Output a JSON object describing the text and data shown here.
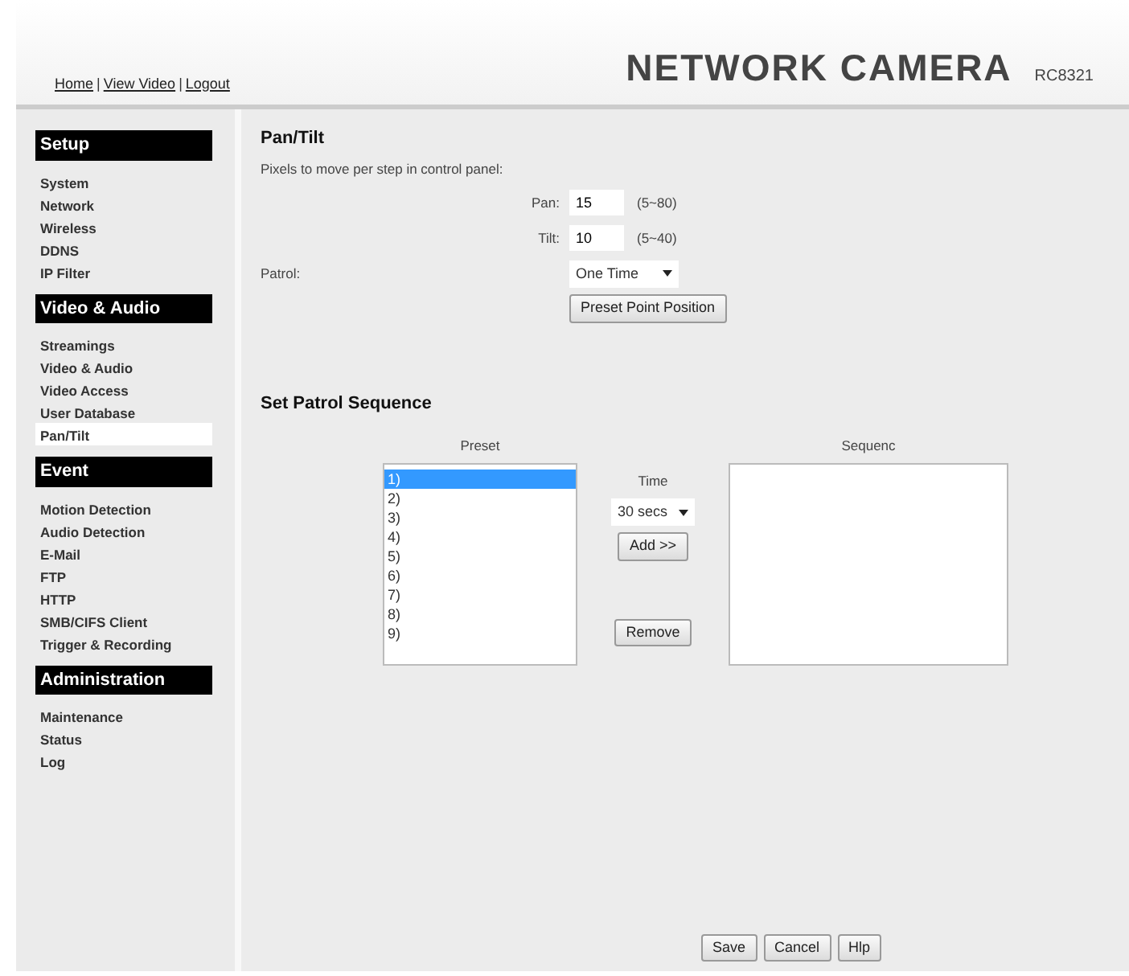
{
  "header": {
    "links": [
      "Home",
      "View Video",
      "Logout"
    ],
    "separator": "|",
    "title": "NETWORK CAMERA",
    "model": "RC8321"
  },
  "sidebar": [
    {
      "heading": "Setup",
      "items": [
        {
          "label": "System",
          "selected": false
        },
        {
          "label": "Network",
          "selected": false
        },
        {
          "label": "Wireless",
          "selected": false
        },
        {
          "label": "DDNS",
          "selected": false
        },
        {
          "label": "IP Filter",
          "selected": false
        }
      ]
    },
    {
      "heading": "Video & Audio",
      "items": [
        {
          "label": "Streamings",
          "selected": false
        },
        {
          "label": "Video & Audio",
          "selected": false
        },
        {
          "label": "Video Access",
          "selected": false
        },
        {
          "label": "User Database",
          "selected": false
        },
        {
          "label": "Pan/Tilt",
          "selected": true
        }
      ]
    },
    {
      "heading": "Event",
      "items": [
        {
          "label": "Motion Detection",
          "selected": false
        },
        {
          "label": "Audio Detection",
          "selected": false
        },
        {
          "label": "E-Mail",
          "selected": false
        },
        {
          "label": "FTP",
          "selected": false
        },
        {
          "label": "HTTP",
          "selected": false
        },
        {
          "label": "SMB/CIFS Client",
          "selected": false
        },
        {
          "label": "Trigger & Recording",
          "selected": false
        }
      ]
    },
    {
      "heading": "Administration",
      "items": [
        {
          "label": "Maintenance",
          "selected": false
        },
        {
          "label": "Status",
          "selected": false
        },
        {
          "label": "Log",
          "selected": false
        }
      ]
    }
  ],
  "pan_tilt": {
    "title": "Pan/Tilt",
    "description": "Pixels to move per step in control panel:",
    "fields": [
      {
        "label": "Pan:",
        "value": "15",
        "range": "(5~80)"
      },
      {
        "label": "Tilt:",
        "value": "10",
        "range": "(5~40)"
      }
    ],
    "patrol": {
      "label": "Patrol:",
      "value": "One Time"
    },
    "preset_button": "Preset Point Position"
  },
  "patrol_sequence": {
    "title": "Set Patrol Sequence",
    "preset": {
      "label": "Preset",
      "items": [
        {
          "label": "1)",
          "selected": true
        },
        {
          "label": "2)",
          "selected": false
        },
        {
          "label": "3)",
          "selected": false
        },
        {
          "label": "4)",
          "selected": false
        },
        {
          "label": "5)",
          "selected": false
        },
        {
          "label": "6)",
          "selected": false
        },
        {
          "label": "7)",
          "selected": false
        },
        {
          "label": "8)",
          "selected": false
        },
        {
          "label": "9)",
          "selected": false
        }
      ]
    },
    "time": {
      "label": "Time",
      "value": "30 secs"
    },
    "add_button": "Add >>",
    "remove_button": "Remove",
    "sequence": {
      "label": "Sequenc"
    }
  },
  "buttons": [
    "Save",
    "Cancel",
    "Hlp"
  ]
}
